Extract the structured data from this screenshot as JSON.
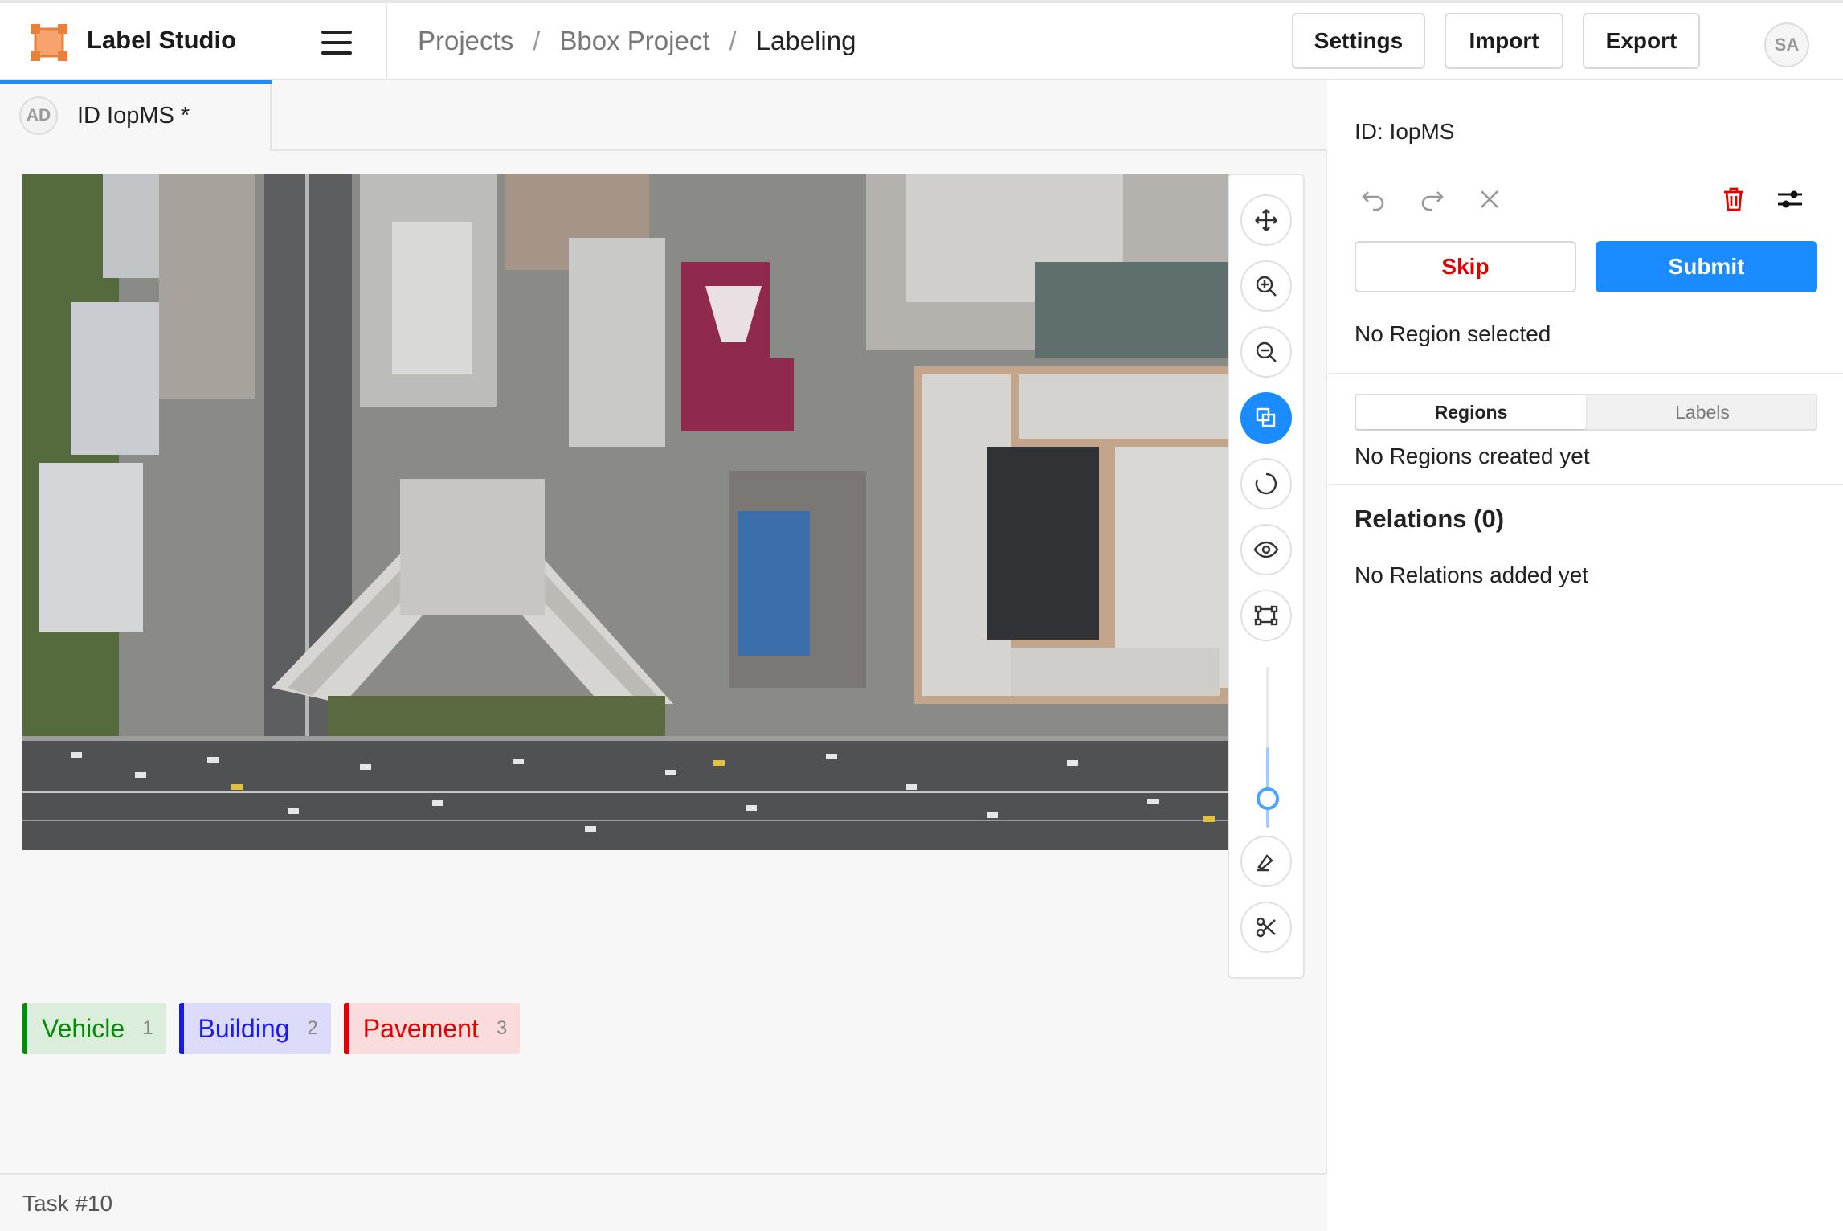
{
  "app": {
    "title": "Label Studio"
  },
  "breadcrumb": {
    "items": [
      "Projects",
      "Bbox Project",
      "Labeling"
    ],
    "separator": "/"
  },
  "header_buttons": {
    "settings": "Settings",
    "import": "Import",
    "export": "Export"
  },
  "user": {
    "initials": "SA"
  },
  "task_tab": {
    "avatar": "AD",
    "label": "ID IopMS *"
  },
  "tools": [
    "move-icon",
    "zoom-in-icon",
    "zoom-out-icon",
    "rectangle-select-icon",
    "rotate-icon",
    "eye-icon",
    "fit-image-icon",
    "brush-icon",
    "scissors-icon"
  ],
  "labels": [
    {
      "name": "Vehicle",
      "hotkey": "1",
      "color": "#0a8a0a",
      "bg": "#dbeedb"
    },
    {
      "name": "Building",
      "hotkey": "2",
      "color": "#1a1aee",
      "bg": "#dcdcfa"
    },
    {
      "name": "Pavement",
      "hotkey": "3",
      "color": "#e00000",
      "bg": "#fbdcdc"
    }
  ],
  "footer": {
    "task": "Task #10"
  },
  "panel": {
    "id": "ID: IopMS",
    "skip": "Skip",
    "submit": "Submit",
    "no_region": "No Region selected",
    "tabs": [
      "Regions",
      "Labels"
    ],
    "no_regions": "No Regions created yet",
    "relations_title": "Relations (0)",
    "no_relations": "No Relations added yet"
  },
  "colors": {
    "accent": "#1a8cff",
    "skip": "#e00000",
    "delete": "#e00000"
  }
}
